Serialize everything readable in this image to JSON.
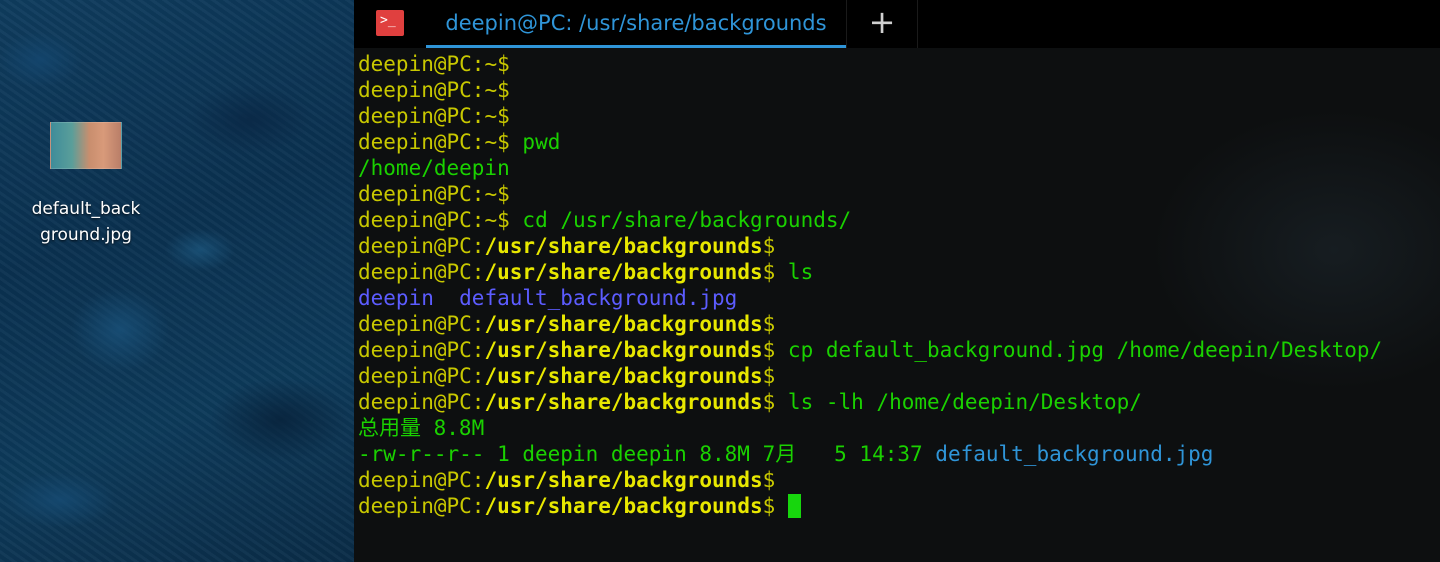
{
  "desktop": {
    "file": {
      "name": "default_background.jpg",
      "label": "default_back\nground.jpg"
    }
  },
  "tabbar": {
    "tab_title": "deepin@PC: /usr/share/backgrounds",
    "new_tab_symbol": "+",
    "terminal_icon_symbol": ">_"
  },
  "terminal": {
    "user_prompt": "deepin@PC",
    "lines": [
      {
        "type": "prompt",
        "path": "~",
        "cmd": ""
      },
      {
        "type": "prompt",
        "path": "~",
        "cmd": ""
      },
      {
        "type": "prompt",
        "path": "~",
        "cmd": ""
      },
      {
        "type": "prompt",
        "path": "~",
        "cmd": "pwd"
      },
      {
        "type": "output",
        "text": "/home/deepin"
      },
      {
        "type": "prompt",
        "path": "~",
        "cmd": ""
      },
      {
        "type": "prompt",
        "path": "~",
        "cmd": "cd /usr/share/backgrounds/"
      },
      {
        "type": "prompt",
        "path": "/usr/share/backgrounds",
        "cmd": ""
      },
      {
        "type": "prompt",
        "path": "/usr/share/backgrounds",
        "cmd": "ls"
      },
      {
        "type": "ls",
        "items": [
          {
            "name": "deepin",
            "kind": "dir"
          },
          {
            "name": "default_background.jpg",
            "kind": "file"
          }
        ]
      },
      {
        "type": "prompt",
        "path": "/usr/share/backgrounds",
        "cmd": ""
      },
      {
        "type": "prompt",
        "path": "/usr/share/backgrounds",
        "cmd": "cp default_background.jpg /home/deepin/Desktop/"
      },
      {
        "type": "prompt",
        "path": "/usr/share/backgrounds",
        "cmd": ""
      },
      {
        "type": "prompt",
        "path": "/usr/share/backgrounds",
        "cmd": "ls -lh /home/deepin/Desktop/"
      },
      {
        "type": "output",
        "text": "总用量 8.8M"
      },
      {
        "type": "lsl",
        "text": "-rw-r--r-- 1 deepin deepin 8.8M 7月   5 14:37 ",
        "file": "default_background.jpg"
      },
      {
        "type": "prompt",
        "path": "/usr/share/backgrounds",
        "cmd": ""
      },
      {
        "type": "prompt",
        "path": "/usr/share/backgrounds",
        "cmd": "",
        "cursor": true
      }
    ]
  },
  "colors": {
    "prompt_user": "#c8c800",
    "prompt_path": "#e8e800",
    "command": "#1ad100",
    "directory": "#5c5cff",
    "file": "#2f95d8",
    "cursor": "#17d60d",
    "tab_accent": "#2f95d8"
  }
}
